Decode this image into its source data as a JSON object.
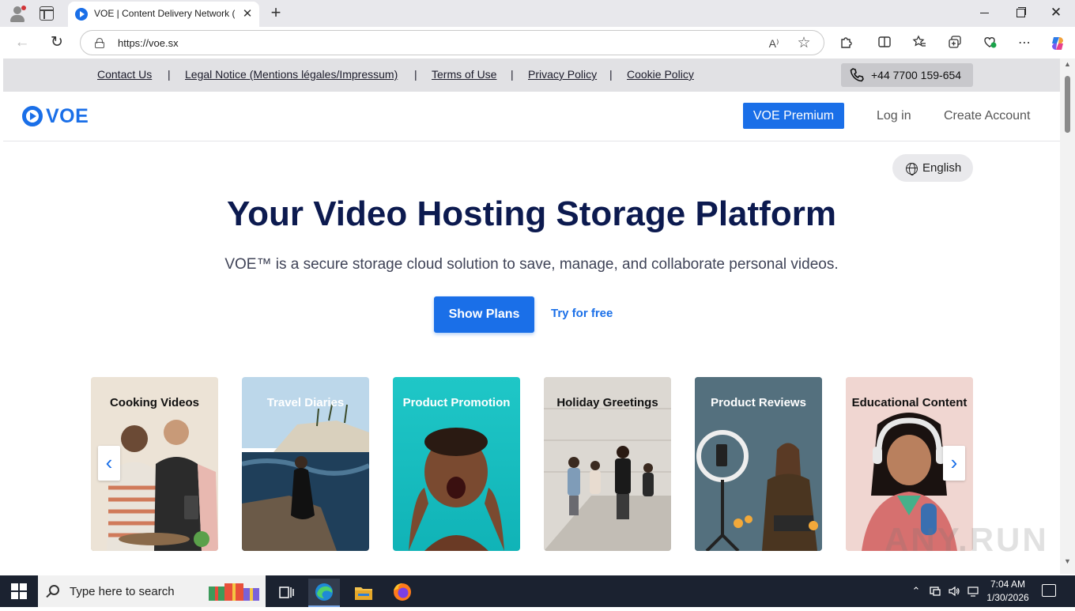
{
  "browser": {
    "tab_title": "VOE | Content Delivery Network (CDN)",
    "url": "https://voe.sx",
    "new_tab_symbol": "+",
    "close_symbol": "✕",
    "read_aloud_symbol": "A⁾",
    "favorite_symbol": "☆"
  },
  "topbar": {
    "links": [
      "Contact Us",
      "Legal Notice (Mentions légales/Impressum)",
      "Terms of Use",
      "Privacy Policy",
      "Cookie Policy"
    ],
    "separator": "|",
    "phone": "+44 7700 159-654"
  },
  "header": {
    "logo_text": "VOE",
    "premium_label": "VOE Premium",
    "login_label": "Log in",
    "create_account_label": "Create Account"
  },
  "language": {
    "label": "English"
  },
  "hero": {
    "title": "Your Video Hosting Storage Platform",
    "subtitle": "VOE™ is a secure storage cloud solution to save, manage, and collaborate personal videos.",
    "show_plans_label": "Show Plans",
    "try_free_label": "Try for free"
  },
  "categories": [
    {
      "label": "Cooking Videos"
    },
    {
      "label": "Travel Diaries"
    },
    {
      "label": "Product Promotion"
    },
    {
      "label": "Holiday Greetings"
    },
    {
      "label": "Product Reviews"
    },
    {
      "label": "Educational Content"
    }
  ],
  "watermark": "ANY.RUN",
  "taskbar": {
    "search_placeholder": "Type here to search",
    "time": "7:04 AM",
    "date": "1/30/2026"
  },
  "colors": {
    "brand_blue": "#1a6fe8",
    "title_navy": "#0c1a4f",
    "topbar_gray": "#e1e1e4",
    "taskbar": "#1b2230"
  }
}
